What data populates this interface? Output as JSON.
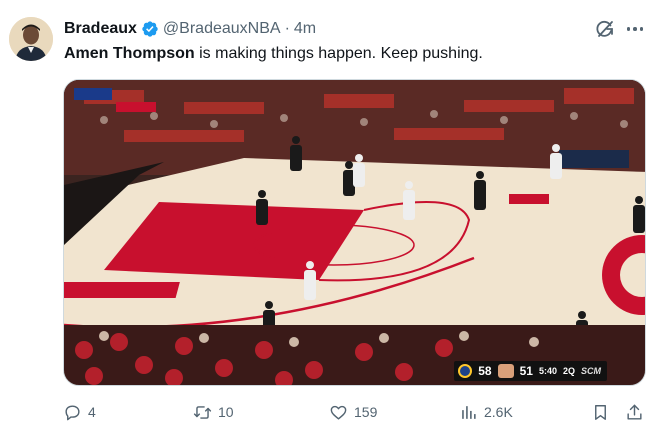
{
  "author": {
    "display_name": "Bradeaux",
    "handle": "@BradeauxNBA",
    "separator": "·",
    "time": "4m"
  },
  "tweet": {
    "mention": "Amen Thompson",
    "text_rest": " is making things happen. Keep pushing."
  },
  "video": {
    "score_away": "58",
    "score_home": "51",
    "clock": "5:40",
    "quarter": "2Q",
    "network": "SCM"
  },
  "actions": {
    "replies": "4",
    "reposts": "10",
    "likes": "159",
    "views": "2.6K"
  },
  "colors": {
    "text_primary": "#0f1419",
    "text_secondary": "#536471",
    "verified": "#1d9bf0",
    "court_red": "#c8102e"
  },
  "icons": [
    "verified-badge-icon",
    "grok-icon",
    "more-icon",
    "reply-icon",
    "repost-icon",
    "like-icon",
    "views-icon",
    "bookmark-icon",
    "share-icon"
  ]
}
